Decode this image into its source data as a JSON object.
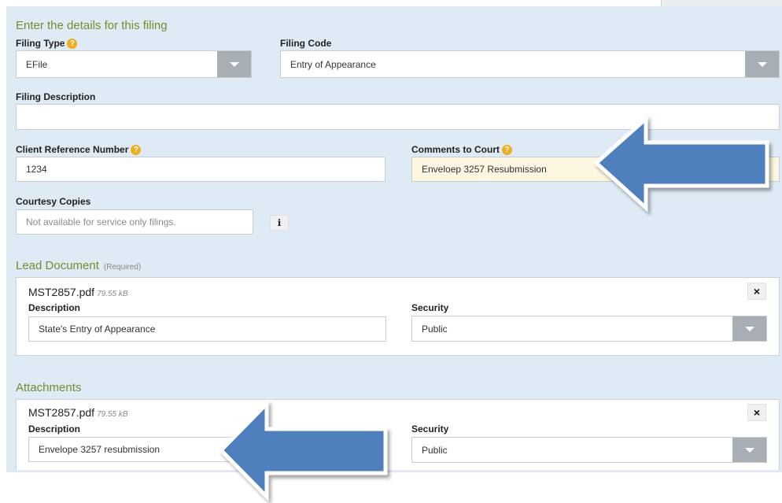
{
  "header": {
    "title": "Enter the details for this filing"
  },
  "filing_type": {
    "label": "Filing Type",
    "value": "EFile"
  },
  "filing_code": {
    "label": "Filing Code",
    "value": "Entry of Appearance"
  },
  "filing_description": {
    "label": "Filing Description",
    "value": ""
  },
  "client_reference": {
    "label": "Client Reference Number",
    "value": "1234"
  },
  "comments_to_court": {
    "label": "Comments to Court",
    "value": "Enveloep 3257 Resubmission"
  },
  "courtesy_copies": {
    "label": "Courtesy Copies",
    "placeholder": "Not available for service only filings."
  },
  "help_glyph": "?",
  "info_glyph": "ℹ",
  "close_glyph": "×",
  "lead_document": {
    "title": "Lead Document",
    "required_note": "(Required)",
    "file_name": "MST2857.pdf",
    "file_size": "79.55 kB",
    "description_label": "Description",
    "description_value": "State's Entry of Appearance",
    "security_label": "Security",
    "security_value": "Public"
  },
  "attachments": {
    "title": "Attachments",
    "file_name": "MST2857.pdf",
    "file_size": "79.55 kB",
    "description_label": "Description",
    "description_value": "Envelope 3257 resubmission",
    "security_label": "Security",
    "security_value": "Public"
  },
  "colors": {
    "panel_bg": "#deebf5",
    "section_title": "#6d8f2e",
    "help_badge": "#f0ad1e",
    "arrow_fill": "#4f7fbd",
    "dropdown_button": "#a7aeb4",
    "comments_bg": "#fdf6e0"
  }
}
